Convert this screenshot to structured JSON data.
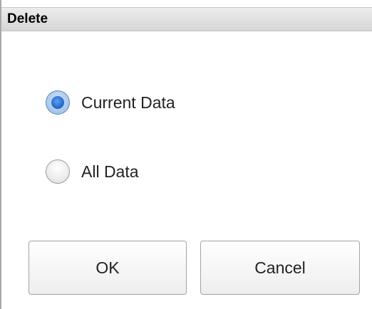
{
  "dialog": {
    "title": "Delete",
    "options": [
      {
        "label": "Current Data",
        "checked": true
      },
      {
        "label": "All Data",
        "checked": false
      }
    ],
    "ok_label": "OK",
    "cancel_label": "Cancel"
  }
}
